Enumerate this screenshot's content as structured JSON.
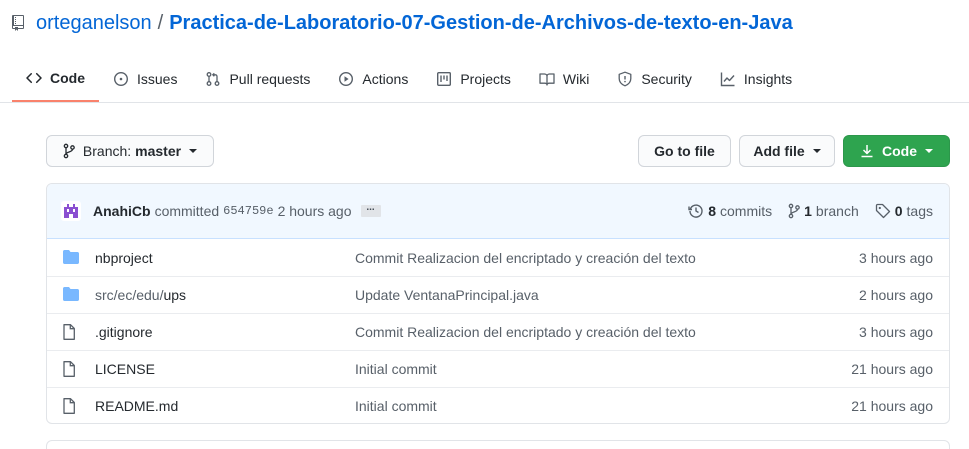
{
  "repo": {
    "owner": "orteganelson",
    "separator": "/",
    "name": "Practica-de-Laboratorio-07-Gestion-de-Archivos-de-texto-en-Java"
  },
  "tabs": [
    {
      "label": "Code",
      "icon": "code-icon",
      "selected": true
    },
    {
      "label": "Issues",
      "icon": "issue-icon"
    },
    {
      "label": "Pull requests",
      "icon": "pull-request-icon"
    },
    {
      "label": "Actions",
      "icon": "play-icon"
    },
    {
      "label": "Projects",
      "icon": "project-icon"
    },
    {
      "label": "Wiki",
      "icon": "book-icon"
    },
    {
      "label": "Security",
      "icon": "shield-icon"
    },
    {
      "label": "Insights",
      "icon": "graph-icon"
    }
  ],
  "toolbar": {
    "branch_prefix": "Branch:",
    "branch_name": "master",
    "goto_file": "Go to file",
    "add_file": "Add file",
    "code": "Code"
  },
  "commit": {
    "author": "AnahiCb",
    "verb": "committed",
    "sha": "654759e",
    "time": "2 hours ago",
    "ellipsis": "...",
    "commits_count": "8",
    "commits_label": "commits",
    "branch_count": "1",
    "branch_label": "branch",
    "tags_count": "0",
    "tags_label": "tags"
  },
  "files": [
    {
      "type": "folder",
      "name": "nbproject",
      "message": "Commit Realizacion del encriptado y creación del texto",
      "age": "3 hours ago"
    },
    {
      "type": "folder",
      "name_muted": "src/ec/edu/",
      "name": "ups",
      "message": "Update VentanaPrincipal.java",
      "age": "2 hours ago"
    },
    {
      "type": "file",
      "name": ".gitignore",
      "message": "Commit Realizacion del encriptado y creación del texto",
      "age": "3 hours ago"
    },
    {
      "type": "file",
      "name": "LICENSE",
      "message": "Initial commit",
      "age": "21 hours ago"
    },
    {
      "type": "file",
      "name": "README.md",
      "message": "Initial commit",
      "age": "21 hours ago"
    }
  ],
  "colors": {
    "link": "#0366d6",
    "selected_tab_underline": "#f9826c",
    "code_button": "#2ea44f",
    "folder_icon": "#79b8ff",
    "commit_header_bg": "#f1f8ff"
  }
}
